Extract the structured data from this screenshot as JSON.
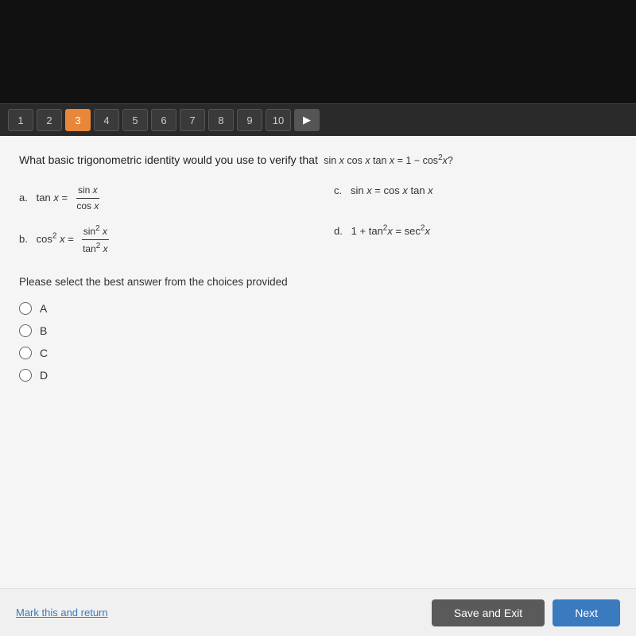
{
  "nav": {
    "items": [
      {
        "label": "1",
        "active": false
      },
      {
        "label": "2",
        "active": false
      },
      {
        "label": "3",
        "active": true
      },
      {
        "label": "4",
        "active": false
      },
      {
        "label": "5",
        "active": false
      },
      {
        "label": "6",
        "active": false
      },
      {
        "label": "7",
        "active": false
      },
      {
        "label": "8",
        "active": false
      },
      {
        "label": "9",
        "active": false
      },
      {
        "label": "10",
        "active": false
      }
    ],
    "arrow_label": "▶"
  },
  "question": {
    "text_prefix": "What basic trigonometric identity would you use to verify that",
    "equation": "sin x cos x tan x = 1 − cos²x?",
    "choices": [
      {
        "id": "a",
        "label": "a.",
        "expression": "tan x = sin x / cos x"
      },
      {
        "id": "c",
        "label": "c.",
        "expression": "sin x = cos x tan x"
      },
      {
        "id": "b",
        "label": "b.",
        "expression": "cos² x = sin² x / tan² x"
      },
      {
        "id": "d",
        "label": "d.",
        "expression": "1 + tan² x = sec² x"
      }
    ]
  },
  "instruction": "Please select the best answer from the choices provided",
  "radio_options": [
    {
      "id": "A",
      "label": "A"
    },
    {
      "id": "B",
      "label": "B"
    },
    {
      "id": "C",
      "label": "C"
    },
    {
      "id": "D",
      "label": "D"
    }
  ],
  "footer": {
    "mark_return": "Mark this and return",
    "save_exit": "Save and Exit",
    "next": "Next"
  }
}
